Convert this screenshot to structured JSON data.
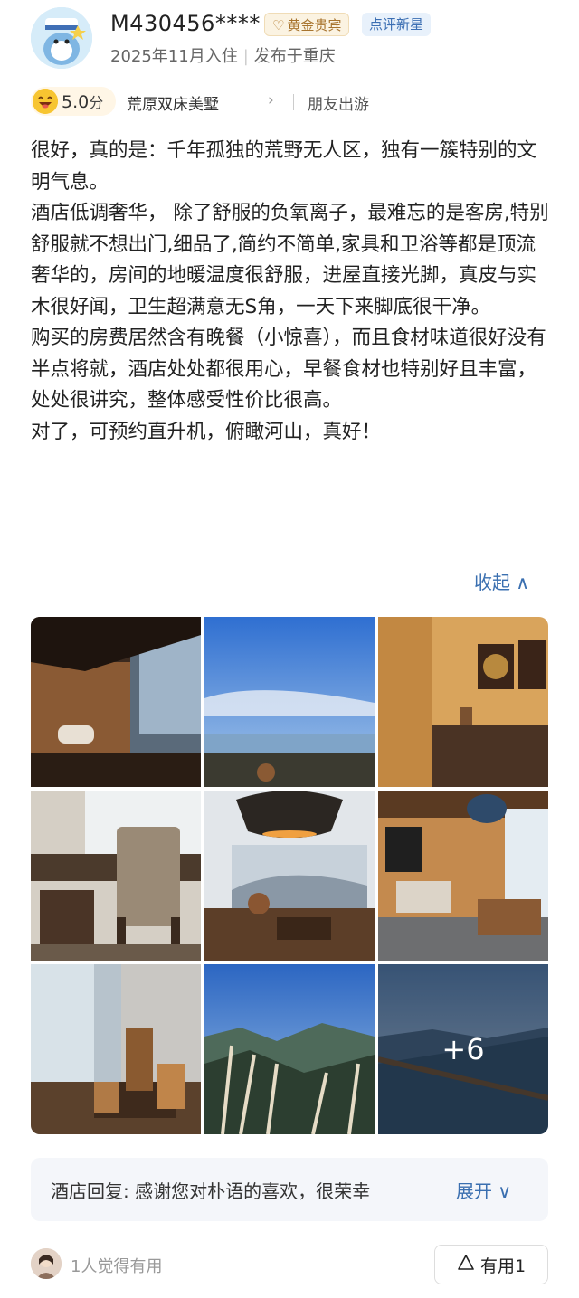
{
  "user": {
    "name": "M430456****",
    "badge_member": "黄金贵宾",
    "badge_review": "点评新星",
    "stay_date": "2025年11月入住",
    "posted_from": "发布于重庆"
  },
  "rating": {
    "score": "5.0",
    "score_unit": "分",
    "room_type": "荒原双床美墅",
    "trip_type": "朋友出游"
  },
  "review": {
    "paragraphs": [
      "很好，真的是：千年孤独的荒野无人区，独有一簇特别的文明气息。",
      "酒店低调奢华， 除了舒服的负氧离子，最难忘的是客房,特别舒服就不想出门,细品了,简约不简单,家具和卫浴等都是顶流奢华的，房间的地暖温度很舒服，进屋直接光脚，真皮与实木很好闻，卫生超满意无S角，一天下来脚底很干净。",
      "购买的房费居然含有晚餐（小惊喜），而且食材味道很好没有半点将就，酒店处处都很用心，早餐食材也特别好且丰富，处处很讲究，整体感受性价比很高。",
      "对了，可预约直升机，俯瞰河山，真好！"
    ],
    "collapse_label": "收起 ∧"
  },
  "photos": {
    "more_count": "+6"
  },
  "hotel_reply": {
    "text": "酒店回复: 感谢您对朴语的喜欢，很荣幸",
    "expand_label": "展开 ∨"
  },
  "footer": {
    "helpful_text": "1人觉得有用",
    "useful_label": "有用1"
  },
  "colors": {
    "link_blue": "#3a6fb0",
    "gold_badge": "#a8742e"
  }
}
